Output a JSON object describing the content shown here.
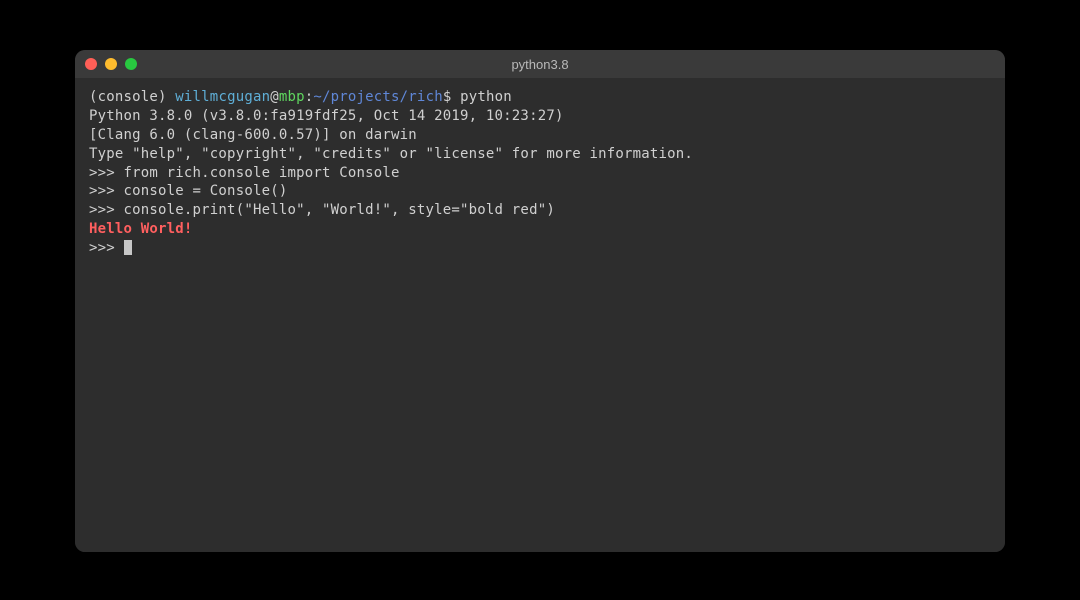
{
  "window": {
    "title": "python3.8"
  },
  "prompt": {
    "console": "(console) ",
    "user": "willmcgugan",
    "at": "@",
    "host": "mbp",
    "colon": ":",
    "path": "~/projects/rich",
    "dollar": "$ ",
    "command": "python"
  },
  "banner": {
    "line1": "Python 3.8.0 (v3.8.0:fa919fdf25, Oct 14 2019, 10:23:27)",
    "line2": "[Clang 6.0 (clang-600.0.57)] on darwin",
    "line3": "Type \"help\", \"copyright\", \"credits\" or \"license\" for more information."
  },
  "repl": {
    "prompt": ">>> ",
    "line1": "from rich.console import Console",
    "line2": "console = Console()",
    "line3": "console.print(\"Hello\", \"World!\", style=\"bold red\")"
  },
  "output": {
    "hello": "Hello World!"
  }
}
